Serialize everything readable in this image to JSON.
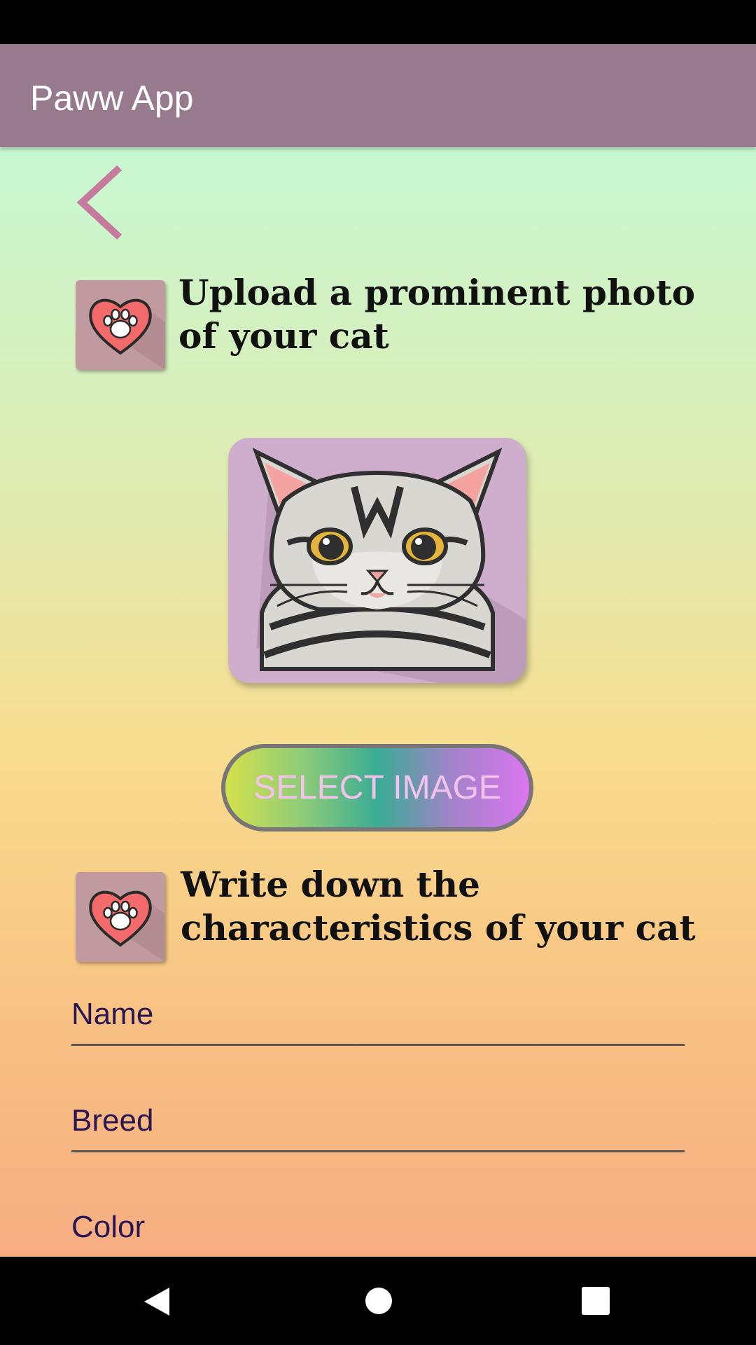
{
  "app": {
    "title": "Paww App"
  },
  "sections": {
    "upload": {
      "heading_line1": "Upload a prominent photo",
      "heading_line2": "of your cat"
    },
    "characteristics": {
      "heading_line1": "Write down the",
      "heading_line2": "characteristics of your cat"
    }
  },
  "buttons": {
    "select_image": "SELECT IMAGE"
  },
  "form": {
    "name_hint": "Name",
    "breed_hint": "Breed",
    "color_hint": "Color"
  },
  "icons": {
    "back": "back-arrow-icon",
    "section": "heart-paw-icon",
    "cat": "cat-face-image",
    "nav_back": "nav-back-icon",
    "nav_home": "nav-home-icon",
    "nav_recents": "nav-recents-icon"
  },
  "colors": {
    "app_bar": "#987a8f",
    "accent": "#c67a9e",
    "heart": "#f26a6a",
    "hint_text": "#2b1654"
  }
}
